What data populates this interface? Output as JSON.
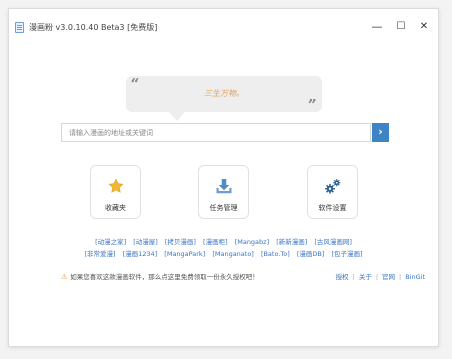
{
  "window": {
    "title": "漫画粉 v3.0.10.40 Beta3 [免费版]",
    "controls": {
      "minimize": "—",
      "maximize": "☐",
      "close": "✕"
    }
  },
  "quote": {
    "open": "“",
    "close": "”",
    "text": "三生万物。"
  },
  "search": {
    "placeholder": "请输入漫画的地址或关键词",
    "button": "›"
  },
  "tiles": [
    {
      "label": "收藏夹",
      "icon": "star-icon"
    },
    {
      "label": "任务管理",
      "icon": "download-icon"
    },
    {
      "label": "软件设置",
      "icon": "gears-icon"
    }
  ],
  "site_links_row1": [
    "[动漫之家]",
    "[动漫屋]",
    "[拷贝漫画]",
    "[漫画柜]",
    "[Mangabz]",
    "[新新漫画]",
    "[古风漫画网]"
  ],
  "site_links_row2": [
    "[非常爱漫]",
    "[漫画1234]",
    "[MangaPark]",
    "[Manganato]",
    "[Bato.To]",
    "[漫画DB]",
    "[包子漫画]"
  ],
  "tip": {
    "icon": "warning-icon",
    "text": "如果您喜欢这款漫画软件，那么点这里免费领取一份永久授权吧！"
  },
  "bottom_links": [
    "授权",
    "关于",
    "官网",
    "BinGit"
  ],
  "colors": {
    "accent": "#3d84c4",
    "link": "#3b74c5",
    "star": "#f2b632",
    "quote": "#e0a060"
  }
}
